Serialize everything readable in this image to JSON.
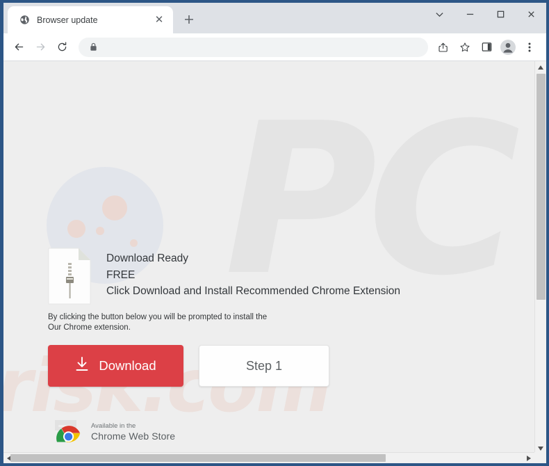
{
  "window": {
    "border_color": "#2d5686",
    "controls": [
      {
        "name": "chevron-down",
        "label": "⌄"
      },
      {
        "name": "minimize",
        "label": "—"
      },
      {
        "name": "maximize",
        "label": "□"
      },
      {
        "name": "close",
        "label": "✕"
      }
    ]
  },
  "tabs": [
    {
      "title": "Browser update",
      "favicon": "globe-icon",
      "close_label": "✕",
      "active": true
    }
  ],
  "newtab": {
    "label": "+"
  },
  "toolbar": {
    "back_label": "←",
    "forward_label": "→",
    "reload_label": "↻",
    "url_value": "",
    "url_placeholder": "",
    "lock_icon": "padlock-icon",
    "share_icon": "share-icon",
    "bookmark_icon": "star-icon",
    "sidepanel_icon": "side-panel-icon",
    "profile_icon": "profile-avatar-icon",
    "menu_icon": "three-dot-menu-icon"
  },
  "page": {
    "background": "#eeeeee",
    "watermark_big": "PC",
    "watermark_small": "risk.com",
    "file_icon": "zip-file-icon",
    "headline_lines": [
      "Download Ready",
      "FREE",
      "Click Download and Install Recommended Chrome Extension"
    ],
    "fine_print_lines": [
      "By clicking the button below you will be prompted to install the",
      "Our Chrome extension."
    ],
    "download_button": {
      "label": "Download",
      "icon": "download-arrow-icon",
      "color": "#dc4046"
    },
    "step_button": {
      "label": "Step 1"
    },
    "chrome_web_store": {
      "small_line": "Available in the",
      "big_line": "Chrome Web Store",
      "logo": "chrome-logo-icon"
    }
  },
  "scrollbars": {
    "v_up": "▲",
    "v_down": "▼",
    "h_left": "◄",
    "h_right": "►"
  }
}
